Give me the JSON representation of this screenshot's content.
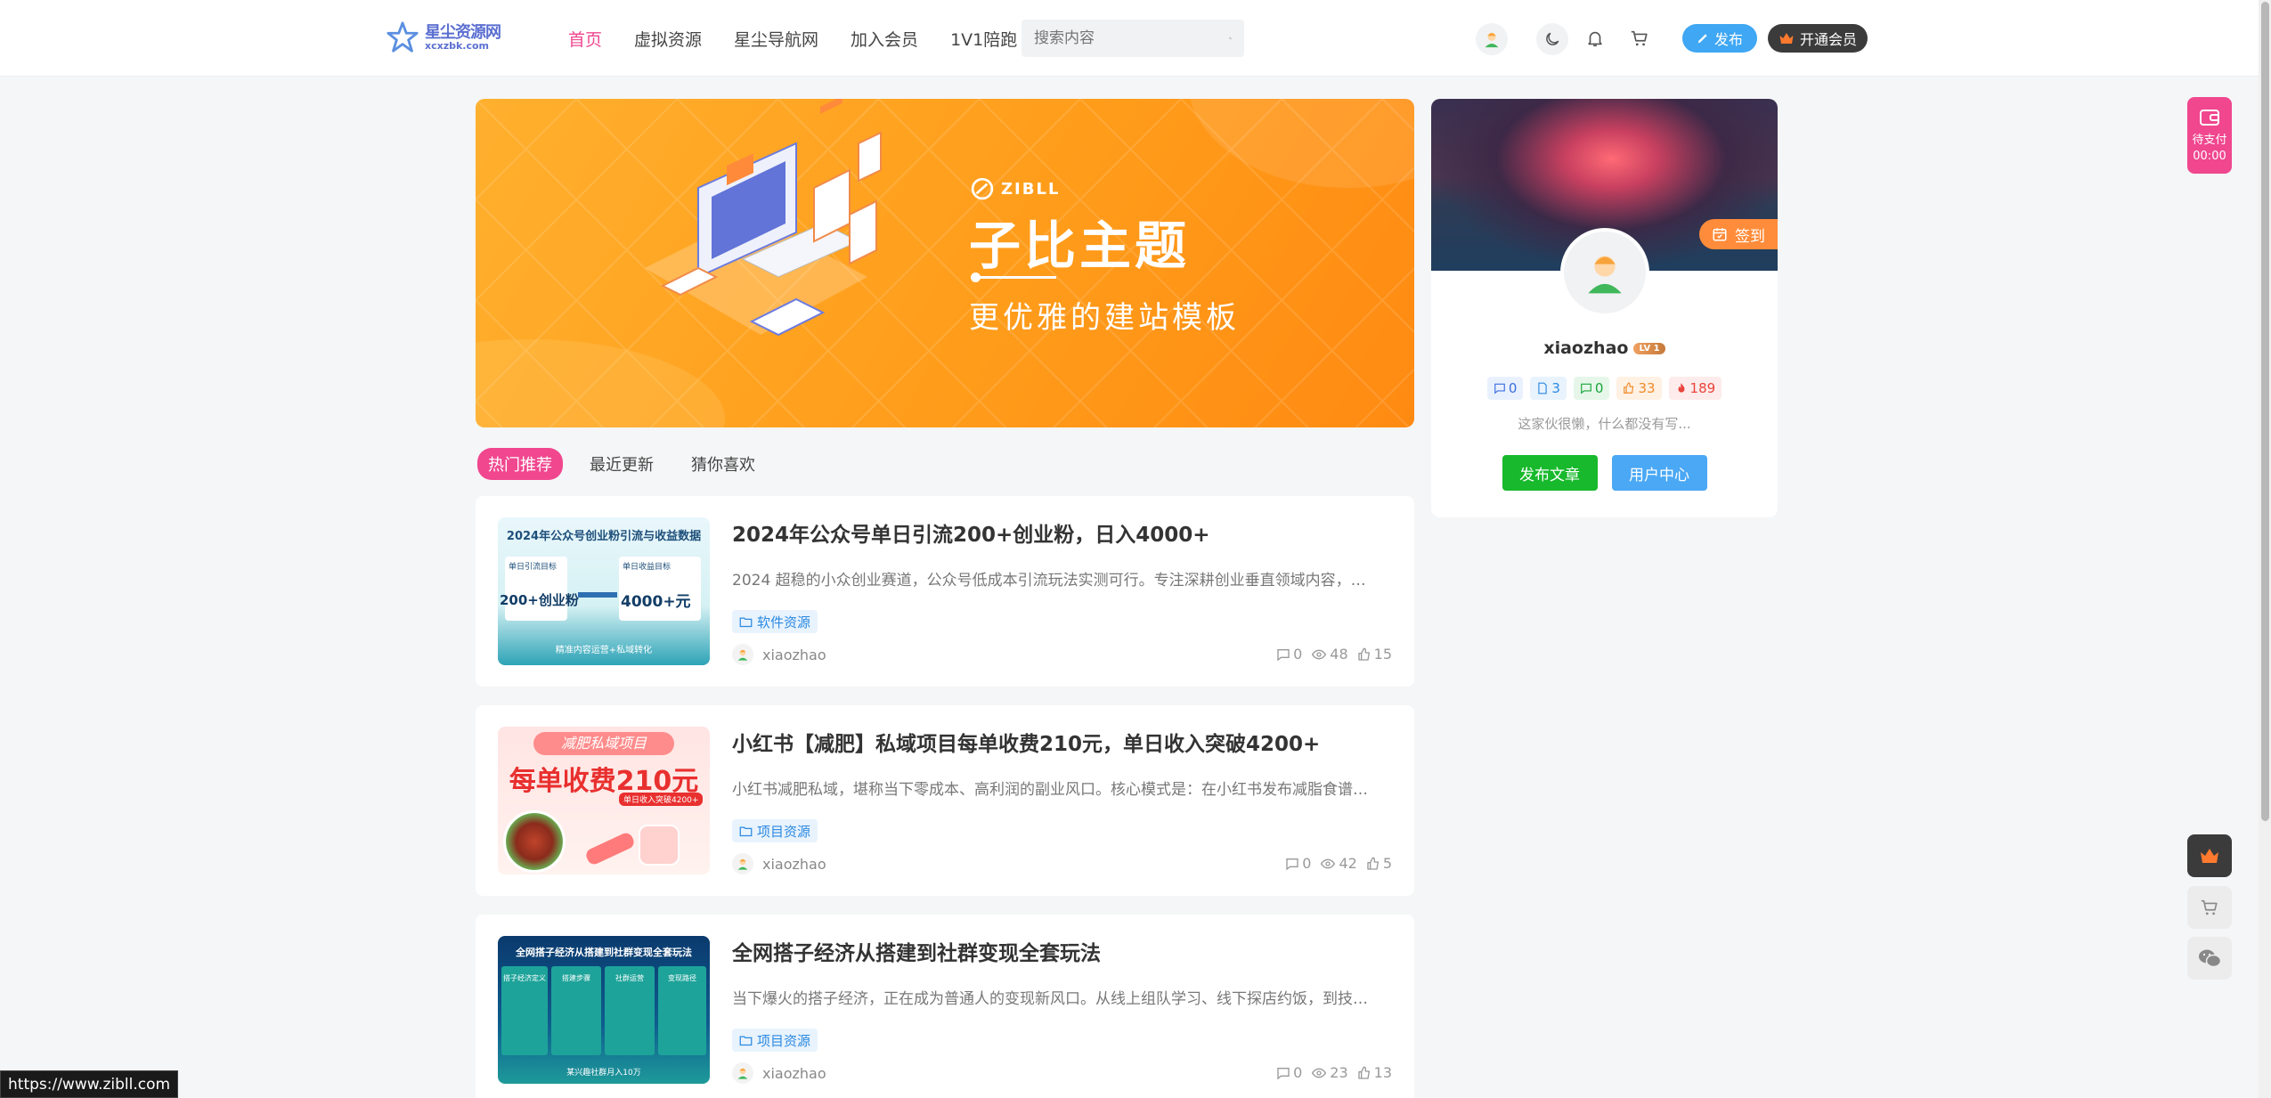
{
  "header": {
    "logo": {
      "line1": "星尘资源网",
      "line2": "xcxzbk.com"
    },
    "nav": [
      "首页",
      "虚拟资源",
      "星尘导航网",
      "加入会员",
      "1V1陪跑"
    ],
    "search_placeholder": "搜索内容",
    "publish_label": "发布",
    "vip_label": "开通会员"
  },
  "banner": {
    "brand": "ZIBLL",
    "title": "子比主题",
    "subtitle": "更优雅的建站模板"
  },
  "tabs": [
    "热门推荐",
    "最近更新",
    "猜你喜欢"
  ],
  "posts": [
    {
      "thumb": {
        "heading": "2024年公众号创业粉引流与收益数据",
        "left_label": "单日引流目标",
        "left_value": "200+创业粉",
        "right_label": "单日收益目标",
        "right_value": "4000+元",
        "footer": "精准内容运营+私域转化"
      },
      "title": "2024年公众号单日引流200+创业粉，日入4000+",
      "desc": "2024 超稳的小众创业赛道，公众号低成本引流玩法实测可行。专注深耕创业垂直领域内容，…",
      "tag": "软件资源",
      "author": "xiaozhao",
      "comments": "0",
      "views": "48",
      "likes": "15"
    },
    {
      "thumb": {
        "heading": "减肥私域项目",
        "big": "每单收费210元",
        "badge": "单日收入突破4200+"
      },
      "title": "小红书【减肥】私域项目每单收费210元，单日收入突破4200+",
      "desc": "小红书减肥私域，堪称当下零成本、高利润的副业风口。核心模式是：在小红书发布减脂食谱…",
      "tag": "项目资源",
      "author": "xiaozhao",
      "comments": "0",
      "views": "42",
      "likes": "5"
    },
    {
      "thumb": {
        "heading": "全网搭子经济从搭建到社群变现全套玩法",
        "cols": [
          "搭子经济定义",
          "搭建步骤",
          "社群运营",
          "变现路径"
        ],
        "footer": "某兴趣社群月入10万"
      },
      "title": "全网搭子经济从搭建到社群变现全套玩法",
      "desc": "当下爆火的搭子经济，正在成为普通人的变现新风口。从线上组队学习、线下探店约饭，到技…",
      "tag": "项目资源",
      "author": "xiaozhao",
      "comments": "0",
      "views": "23",
      "likes": "13"
    }
  ],
  "user_card": {
    "sign_label": "签到",
    "name": "xiaozhao",
    "level": "LV 1",
    "stats": [
      "0",
      "3",
      "0",
      "33",
      "189"
    ],
    "bio": "这家伙很懒，什么都没有写...",
    "btn_post": "发布文章",
    "btn_center": "用户中心"
  },
  "float": {
    "pay_label": "待支付",
    "pay_time": "00:00"
  },
  "status_url": "https://www.zibll.com",
  "colors": {
    "accent": "#f0478f",
    "blue": "#3fa7f3",
    "green": "#18b92c",
    "orange": "#ff9d1b"
  }
}
